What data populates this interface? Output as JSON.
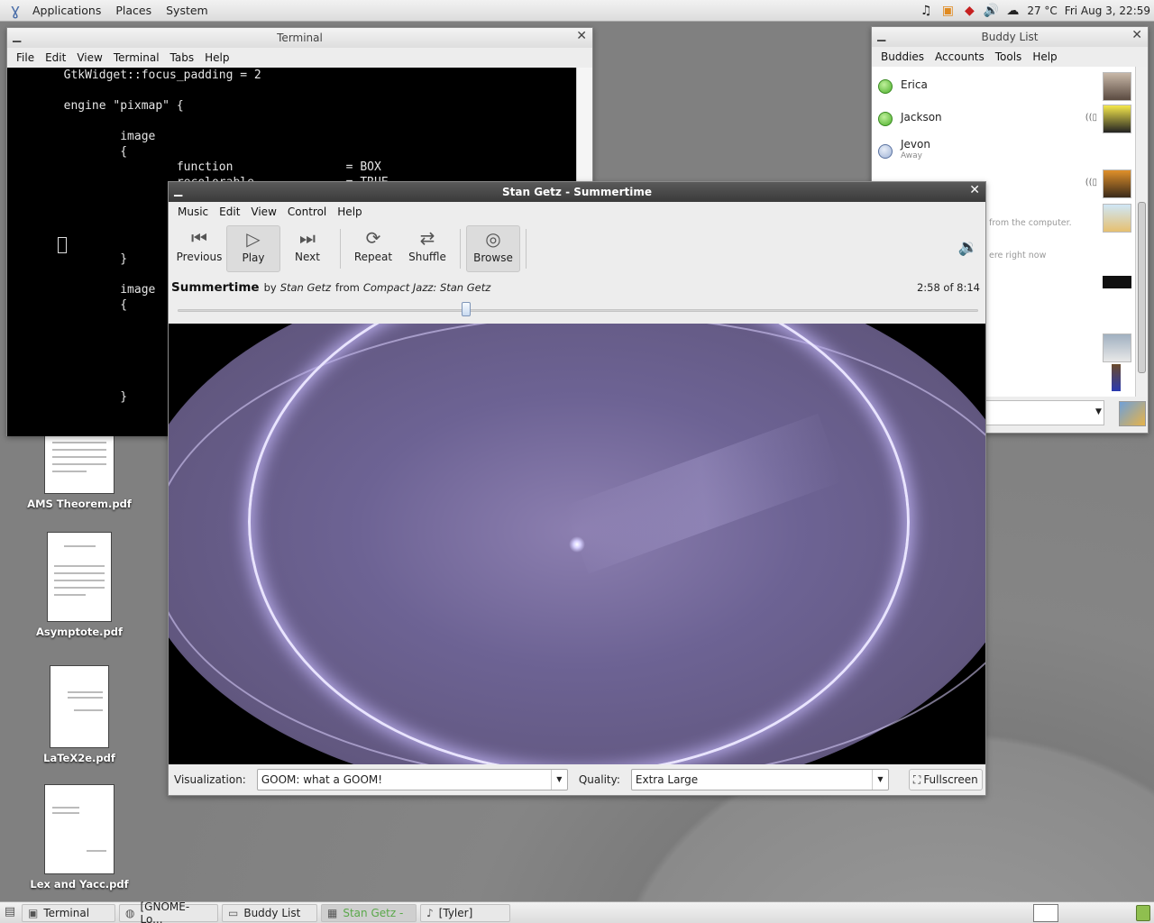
{
  "top_panel": {
    "menus": [
      "Applications",
      "Places",
      "System"
    ],
    "tray": {
      "temperature": "27 °C",
      "clock": "Fri Aug  3, 22:59"
    }
  },
  "terminal": {
    "title": "Terminal",
    "menu": [
      "File",
      "Edit",
      "View",
      "Terminal",
      "Tabs",
      "Help"
    ],
    "lines": [
      "        GtkWidget::focus_padding = 2",
      "",
      "        engine \"pixmap\" {",
      "",
      "                image",
      "                {",
      "                        function                = BOX",
      "                        recolorable             = TRUE",
      "",
      "",
      "",
      "",
      "                }",
      "",
      "                image",
      "                {",
      "",
      "",
      "",
      "",
      "",
      "                }"
    ]
  },
  "buddy_list": {
    "title": "Buddy List",
    "menu": [
      "Buddies",
      "Accounts",
      "Tools",
      "Help"
    ],
    "buddies": [
      {
        "name": "Erica",
        "status_text": "",
        "status": "available"
      },
      {
        "name": "Jackson",
        "status_text": "",
        "status": "available"
      },
      {
        "name": "Jevon",
        "status_text": "Away",
        "status": "away"
      }
    ],
    "faded_texts": [
      "from the computer.",
      "ere right now"
    ]
  },
  "rhythmbox": {
    "title": "Stan Getz - Summertime",
    "menu": [
      "Music",
      "Edit",
      "View",
      "Control",
      "Help"
    ],
    "toolbar": {
      "previous": "Previous",
      "play": "Play",
      "next": "Next",
      "repeat": "Repeat",
      "shuffle": "Shuffle",
      "browse": "Browse"
    },
    "song": {
      "title": "Summertime",
      "by_word": "by",
      "artist": "Stan Getz",
      "from_word": "from",
      "album": "Compact Jazz: Stan Getz",
      "time": "2:58 of 8:14",
      "progress_seconds": 178,
      "duration_seconds": 494
    },
    "bottom": {
      "visualization_label": "Visualization:",
      "visualization_value": "GOOM: what a GOOM!",
      "quality_label": "Quality:",
      "quality_value": "Extra Large",
      "fullscreen_label": "Fullscreen"
    }
  },
  "desktop_icons": [
    {
      "label": "AMS Theorem.pdf"
    },
    {
      "label": "Asymptote.pdf"
    },
    {
      "label": "LaTeX2e.pdf"
    },
    {
      "label": "Lex and Yacc.pdf"
    }
  ],
  "taskbar": {
    "tasks": [
      {
        "label": "Terminal"
      },
      {
        "label": "[GNOME-Lo..."
      },
      {
        "label": "Buddy List"
      },
      {
        "label": "Stan Getz -"
      },
      {
        "label": "[Tyler]"
      }
    ]
  },
  "colors": {
    "title_active": "#3a3a3a",
    "available_status": "#4caf2a",
    "active_task_text": "#5aa84a",
    "viz_ring": "#e9e4ff"
  }
}
